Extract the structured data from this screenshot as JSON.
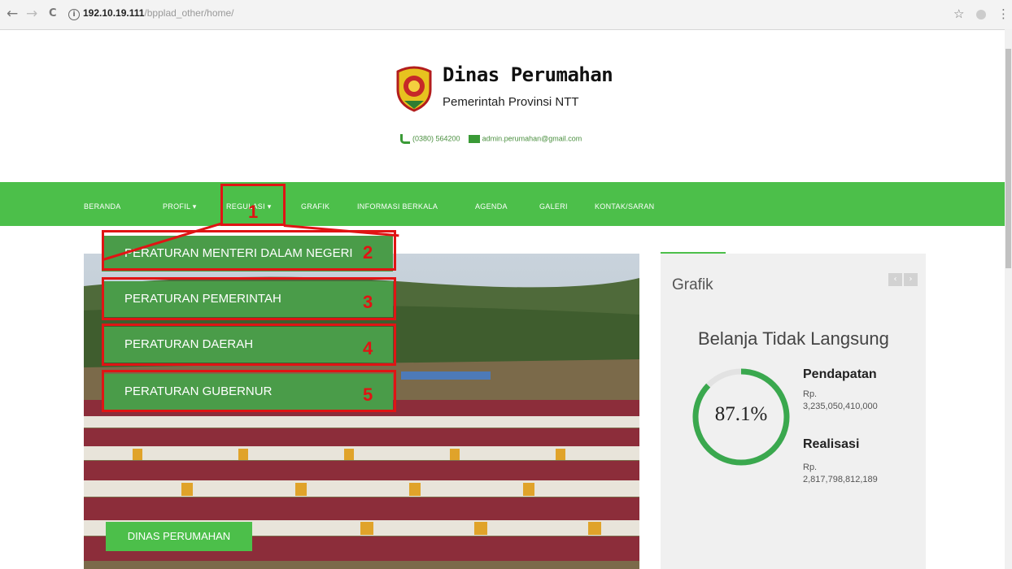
{
  "browser": {
    "back_glyph": "←",
    "forward_glyph": "→",
    "reload_glyph": "C",
    "url_host": "192.10.19.111",
    "url_path": "/bpplad_other/home/",
    "star_glyph": "☆",
    "menu_glyph": "⋮"
  },
  "header": {
    "title": "Dinas Perumahan",
    "subtitle": "Pemerintah Provinsi NTT",
    "phone": "(0380) 564200",
    "email": "admin.perumahan@gmail.com"
  },
  "nav": {
    "items": [
      "BERANDA",
      "PROFIL ▾",
      "REGULASI ▾",
      "GRAFIK",
      "INFORMASI BERKALA",
      "AGENDA",
      "GALERI",
      "KONTAK/SARAN"
    ]
  },
  "dropdown": {
    "items": [
      "PERATURAN MENTERI DALAM NEGERI",
      "PERATURAN PEMERINTAH",
      "PERATURAN DAERAH",
      "PERATURAN GUBERNUR"
    ]
  },
  "annotations": [
    "1",
    "2",
    "3",
    "4",
    "5"
  ],
  "hero": {
    "banner": "DINAS PERUMAHAN"
  },
  "widget": {
    "title": "Grafik",
    "ctrl_prev": "‹",
    "ctrl_next": "›",
    "chart_title": "Belanja Tidak Langsung",
    "percent_label": "87.1%",
    "percent_value": 87.1,
    "pendapatan_label": "Pendapatan",
    "pendapatan_currency": "Rp.",
    "pendapatan_value": "3,235,050,410,000",
    "realisasi_label": "Realisasi",
    "realisasi_currency": "Rp.",
    "realisasi_value": "2,817,798,812,189"
  },
  "colors": {
    "brand_green": "#4cbf4a",
    "menu_green": "#4a9c49",
    "annotation_red": "#e01414"
  }
}
